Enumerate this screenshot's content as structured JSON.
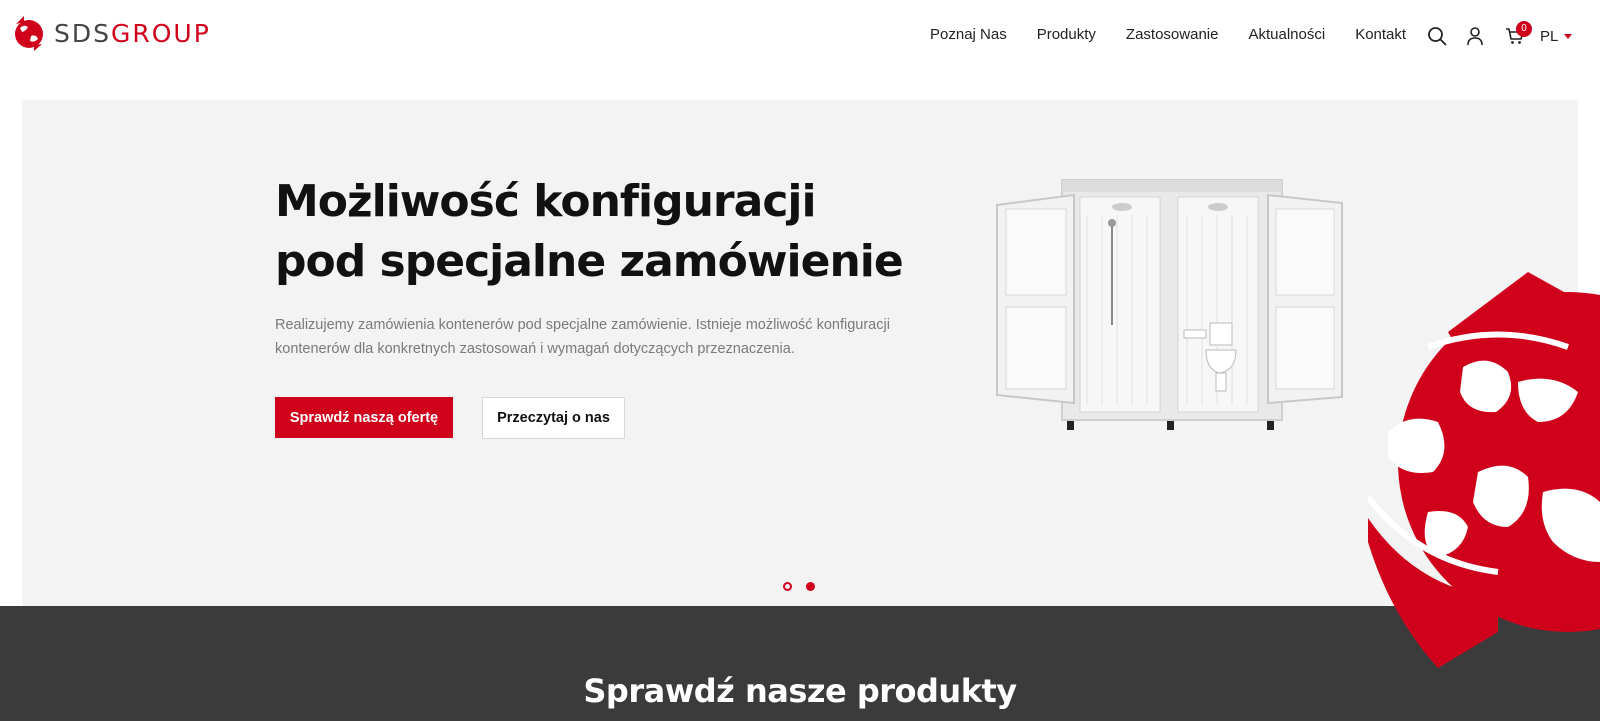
{
  "brand": {
    "logo_text_part1": "SDS",
    "logo_text_part2": "GROUP",
    "accent_color": "#d0021b"
  },
  "nav": {
    "items": [
      {
        "label": "Poznaj Nas"
      },
      {
        "label": "Produkty"
      },
      {
        "label": "Zastosowanie"
      },
      {
        "label": "Aktualności"
      },
      {
        "label": "Kontakt"
      }
    ]
  },
  "header_icons": {
    "search": "search-icon",
    "account": "user-icon",
    "cart": "cart-icon",
    "cart_count": "0",
    "language": "PL"
  },
  "hero": {
    "title": "Możliwość konfiguracji pod specjalne zamówienie",
    "description": "Realizujemy zamówienia kontenerów pod specjalne zamówienie. Istnieje możliwość konfiguracji kontenerów dla konkretnych zastosowań i wymagań dotyczących przeznaczenia.",
    "primary_button": "Sprawdź naszą ofertę",
    "secondary_button": "Przeczytaj o nas",
    "slider_active_index": 2,
    "slider_count": 2
  },
  "products_section": {
    "title": "Sprawdź nasze produkty"
  }
}
